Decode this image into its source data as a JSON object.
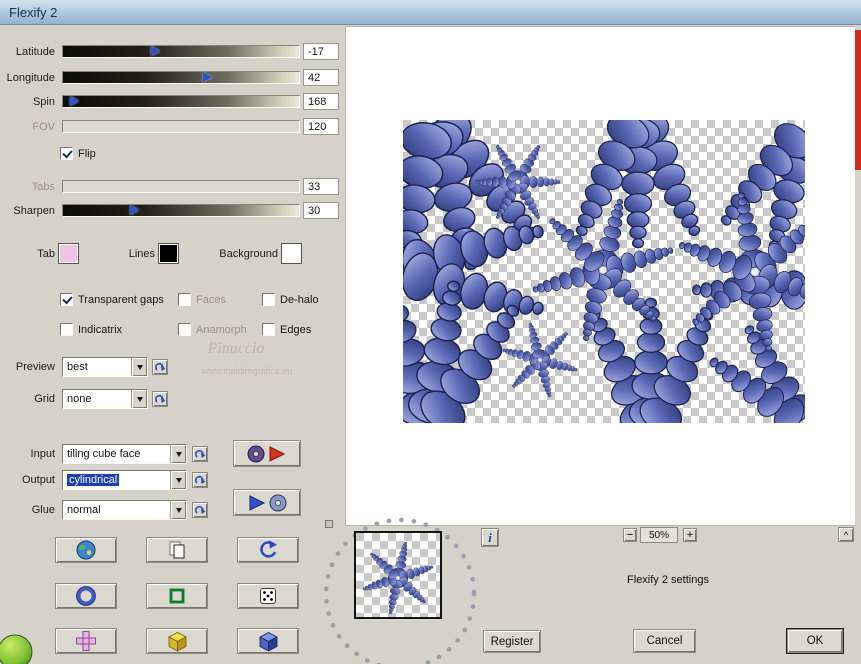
{
  "window": {
    "title": "Flexify 2"
  },
  "sliders": [
    {
      "label": "Latitude",
      "value": "-17",
      "enabled": true
    },
    {
      "label": "Longitude",
      "value": "42",
      "enabled": true
    },
    {
      "label": "Spin",
      "value": "168",
      "enabled": true
    },
    {
      "label": "FOV",
      "value": "120",
      "enabled": false
    },
    {
      "label": "Tabs",
      "value": "33",
      "enabled": false
    },
    {
      "label": "Sharpen",
      "value": "30",
      "enabled": true
    }
  ],
  "flip": {
    "label": "Flip",
    "checked": true
  },
  "swatches": [
    {
      "label": "Tab",
      "color": "#f0c2ea"
    },
    {
      "label": "Lines",
      "color": "#000000"
    },
    {
      "label": "Background",
      "color": "#ffffff"
    }
  ],
  "checkboxes": [
    {
      "label": "Transparent gaps",
      "checked": true
    },
    {
      "label": "Faces",
      "checked": false
    },
    {
      "label": "De-halo",
      "checked": false
    },
    {
      "label": "Indicatrix",
      "checked": false
    },
    {
      "label": "Anamorph",
      "checked": false
    },
    {
      "label": "Edges",
      "checked": false
    }
  ],
  "selects": {
    "preview": {
      "label": "Preview",
      "value": "best"
    },
    "grid": {
      "label": "Grid",
      "value": "none"
    },
    "input": {
      "label": "Input",
      "value": "tiling cube face"
    },
    "output": {
      "label": "Output",
      "value": "cylindrical"
    },
    "glue": {
      "label": "Glue",
      "value": "normal"
    }
  },
  "watermark": {
    "name": "Pinuccia",
    "url": "www.maidiregrafica.eu"
  },
  "footer": {
    "info": "i",
    "zoom_out": "−",
    "zoom_value": "50%",
    "zoom_in": "+",
    "collapse": "^",
    "settings": "Flexify 2 settings",
    "register": "Register",
    "cancel": "Cancel",
    "ok": "OK"
  }
}
